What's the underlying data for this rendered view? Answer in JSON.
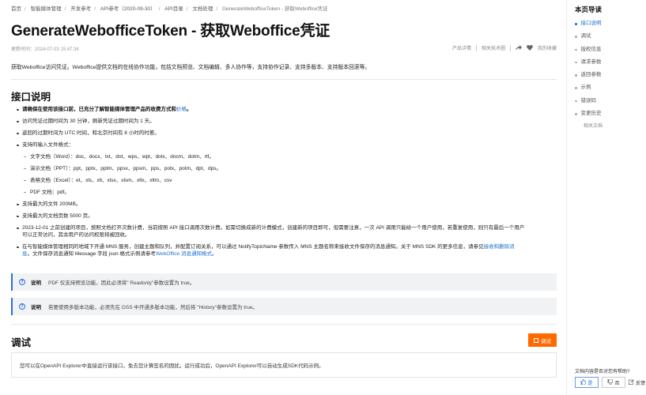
{
  "breadcrumb": [
    "首页",
    "智能媒体管理",
    "开发参考",
    "API参考（2020-09-30）",
    "API目录",
    "文档处理",
    "GenerateWebofficeToken - 获取Weboffice凭证"
  ],
  "page": {
    "title": "GenerateWebofficeToken - 获取Weboffice凭证",
    "updated": "更新时间：2024-07-03 15:47:34",
    "product_detail": "产品详情",
    "related_tech": "相关技术圈",
    "my_favorites": "我的收藏",
    "intro": "获取Weboffice访问凭证。Weboffice提供文档的在线协作功能，包括文档预览、文档编辑、多人协作等，支持协作记录、支持多版本、支持版本回滚等。"
  },
  "api_description": {
    "heading": "接口说明",
    "billing_note_bold": "请确保在使用该接口前，已充分了解智能媒体管理产品的收费方式和",
    "billing_link": "价格",
    "billing_tail": "。",
    "items": [
      "访问凭证过期时间为 30 分钟，刷新凭证过期时间为 1 天。",
      "返回的过期时间为 UTC 时间，和北京时间有 8 小时的时差。",
      "支持的输入文件格式："
    ],
    "formats": [
      "文字文档（Word）：doc、docx、txt、dot、wps、wpt、dotx、docm、dotm、rtf。",
      "演示文档（PPT）：ppt、pptx、pptm、ppsx、ppsm、pps、potx、potm、dpt、dps。",
      "表格文档（Excel）：et、xls、xlt、xlsx、xlsm、xltx、xltm、csv",
      "PDF 文档：pdf。"
    ],
    "max_size": "支持最大的文件 200MB。",
    "max_pages": "支持最大的文档页数 5000 页。",
    "billing_change_line1": "2023-12-01 之前创建的项目，按照文档打开次数计费，当前按照 API 接口调用次数计费。如需切换成新的计费模式，创建新的项目即可，但需要注意，一次 API 调用只能给一个用户使用，若重复使用，则只有最后一个用户",
    "billing_change_line2": "可以正常访问，其余用户的访问权限将被回收。",
    "mns_line1_a": "在与智能媒体管理相同的地域下开通 MNS 服务，创建主题和队列，并配置订阅关系，可以通过 NotifyTopicName 参数传入 MNS 主题名称来接收文件保存的消息通知。关于 MNS SDK 的更多信息，请参见",
    "mns_link1": "接收和删除消",
    "mns_link1b": "息",
    "mns_line2_a": "。文件保存消息通知 Message 字段 json 格式示例请参考",
    "mns_link2": "WebOffice 消息通知格式",
    "mns_line2_b": "。"
  },
  "callouts": [
    {
      "label": "说明",
      "text": "PDF 仅支持预览功能，因此必须将\" Readonly\"参数设置为 true。"
    },
    {
      "label": "说明",
      "text": "若要使用多版本功能，必须先在 OSS 中开通多版本功能，然后将 \"History\"参数设置为 true。"
    }
  ],
  "debug": {
    "heading": "调试",
    "button": "调试",
    "text": "您可以在OpenAPI Explorer中直接运行该接口，免去您计算签名的困扰。运行成功后，OpenAPI Explorer可以自动生成SDK代码示例。"
  },
  "toc": {
    "title": "本页导读",
    "items": [
      {
        "label": "接口说明",
        "active": true
      },
      {
        "label": "调试",
        "active": false
      },
      {
        "label": "授权信息",
        "active": false
      },
      {
        "label": "请求参数",
        "active": false
      },
      {
        "label": "返回参数",
        "active": false
      },
      {
        "label": "示例",
        "active": false
      },
      {
        "label": "错误码",
        "active": false
      },
      {
        "label": "变更历史",
        "active": false
      }
    ],
    "related": "相关文档"
  },
  "feedback": {
    "question": "文档内容是否对您有帮助?",
    "yes": "是",
    "no": "否",
    "report": "反馈"
  },
  "colors": {
    "accent": "#1b6fd6",
    "orange": "#ff6a00",
    "callout_bg": "#f1f2f4"
  }
}
